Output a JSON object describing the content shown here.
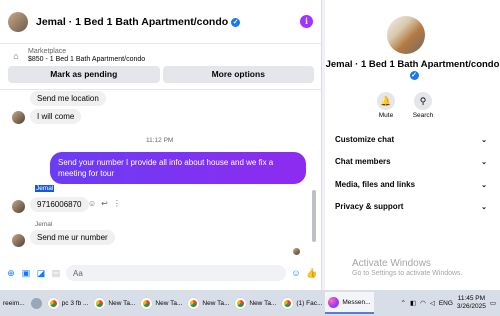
{
  "chat": {
    "title": "Jemal · 1 Bed 1 Bath Apartment/condo",
    "marketplace_label": "Marketplace",
    "listing": "$850 - 1 Bed 1 Bath Apartment/condo",
    "mark_pending_label": "Mark as pending",
    "more_options_label": "More options",
    "messages": [
      {
        "from": "them",
        "text": "Send me location"
      },
      {
        "from": "them",
        "text": "I will come"
      },
      {
        "type": "time",
        "text": "11:12 PM"
      },
      {
        "from": "me",
        "text": "Send your number I provide all info about house and we fix a meeting for tour"
      },
      {
        "from": "them",
        "sender": "Jemal",
        "text": "9716006870"
      },
      {
        "from": "them",
        "sender": "Jemal",
        "text": "Send me ur number"
      }
    ],
    "composer_placeholder": "Aa"
  },
  "info_panel": {
    "title": "Jemal · 1 Bed 1 Bath Apartment/condo",
    "actions": [
      {
        "label": "Mute",
        "icon": "bell-icon"
      },
      {
        "label": "Search",
        "icon": "search-icon"
      }
    ],
    "sections": [
      "Customize chat",
      "Chat members",
      "Media, files and links",
      "Privacy & support"
    ]
  },
  "watermark": {
    "title": "Activate Windows",
    "subtitle": "Go to Settings to activate Windows."
  },
  "taskbar": {
    "items": [
      {
        "label": "reeim...",
        "icon": "chrome-icon"
      },
      {
        "label": "",
        "icon": "app-icon"
      },
      {
        "label": "pc 3 fb ...",
        "icon": "chrome-icon"
      },
      {
        "label": "New Ta...",
        "icon": "chrome-icon"
      },
      {
        "label": "New Ta...",
        "icon": "chrome-icon"
      },
      {
        "label": "New Ta...",
        "icon": "chrome-icon"
      },
      {
        "label": "New Ta...",
        "icon": "chrome-icon"
      },
      {
        "label": "(1) Fac...",
        "icon": "chrome-icon"
      },
      {
        "label": "Messen...",
        "icon": "messenger-icon"
      }
    ],
    "language": "ENG",
    "time": "11:45 PM",
    "date": "3/26/2025"
  },
  "colors": {
    "accent": "#0a7cff",
    "outgoing_bubble": "#7a2cf5",
    "verified": "#1877f2"
  }
}
